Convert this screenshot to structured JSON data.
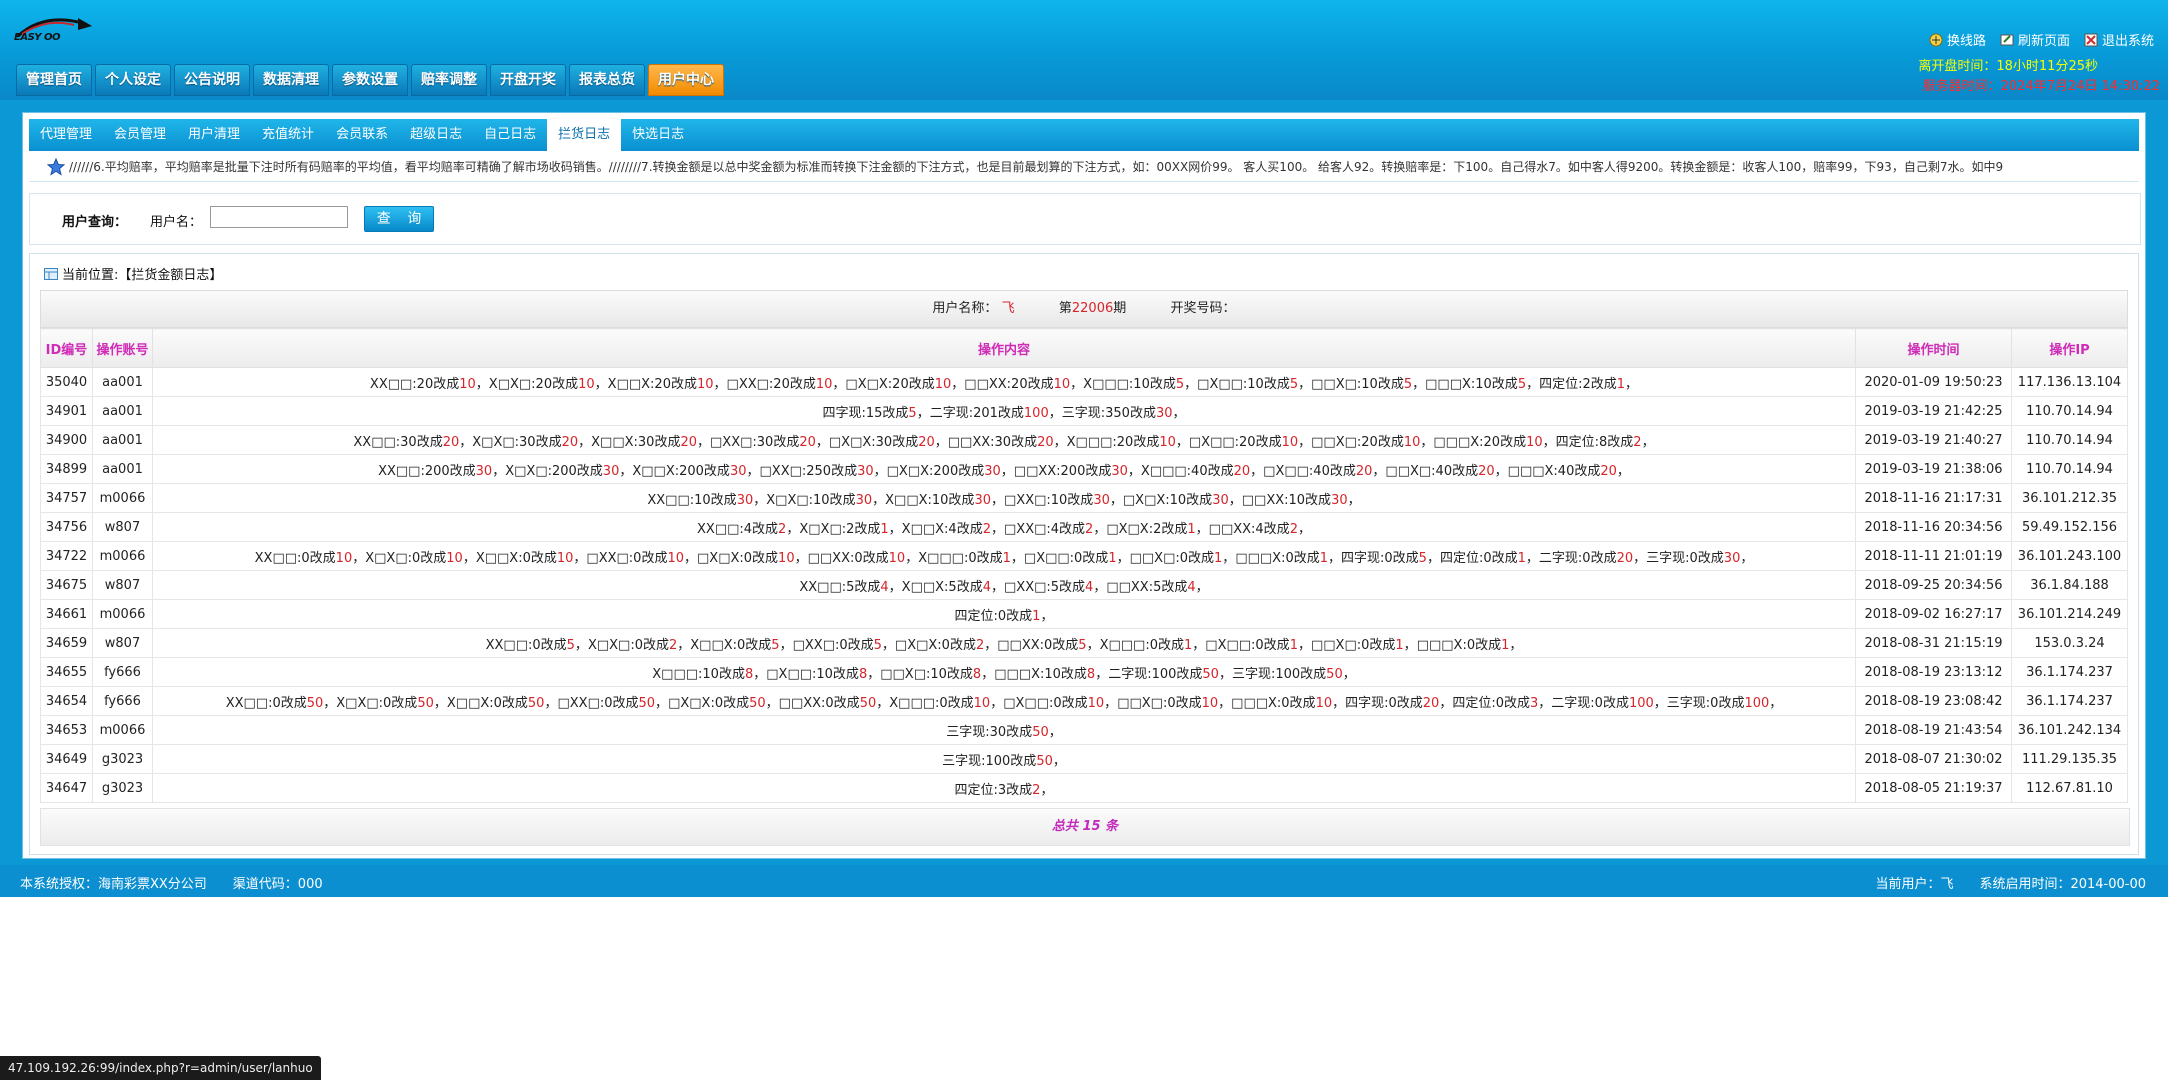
{
  "header": {
    "logo_text": "EASY OO",
    "nav": [
      "管理首页",
      "个人设定",
      "公告说明",
      "数据清理",
      "参数设置",
      "赔率调整",
      "开盘开奖",
      "报表总货",
      "用户中心"
    ],
    "links": [
      {
        "label": "换线路",
        "icon": "route-icon"
      },
      {
        "label": "刷新页面",
        "icon": "refresh-icon"
      },
      {
        "label": "退出系统",
        "icon": "logout-icon"
      }
    ],
    "time_label": "离开盘时间：18小时11分25秒",
    "server_time": "服务器时间：2024年7月24日 14:30:22"
  },
  "subnav": [
    "代理管理",
    "会员管理",
    "用户清理",
    "充值统计",
    "会员联系",
    "超级日志",
    "自己日志",
    "拦货日志",
    "快选日志"
  ],
  "marquee": "//////6.平均赔率，平均赔率是批量下注时所有码赔率的平均值，看平均赔率可精确了解市场收码销售。////////7.转换金额是以总中奖金额为标准而转换下注金额的下注方式，也是目前最划算的下注方式，如：00XX网价99。  客人买100。  给客人92。转换赔率是：下100。自己得水7。如中客人得9200。转换金额是：收客人100，赔率99，下93，自己剩7水。如中9",
  "search": {
    "label": "用户查询：",
    "field_label": "用户名：",
    "value": "",
    "button": "查 询"
  },
  "breadcrumb": "当前位置:【拦货金额日志】",
  "info": {
    "user_label": "用户名称：",
    "user": "飞",
    "period_prefix": "第",
    "period": "22006",
    "period_suffix": "期",
    "draw_label": "开奖号码："
  },
  "table": {
    "headers": [
      "ID编号",
      "操作账号",
      "操作内容",
      "操作时间",
      "操作IP"
    ],
    "rows": [
      {
        "id": "35040",
        "account": "aa001",
        "content": [
          [
            "XX□□:20改成",
            "10"
          ],
          [
            "X□X□:20改成",
            "10"
          ],
          [
            "X□□X:20改成",
            "10"
          ],
          [
            "□XX□:20改成",
            "10"
          ],
          [
            "□X□X:20改成",
            "10"
          ],
          [
            "□□XX:20改成",
            "10"
          ],
          [
            "X□□□:10改成",
            "5"
          ],
          [
            "□X□□:10改成",
            "5"
          ],
          [
            "□□X□:10改成",
            "5"
          ],
          [
            "□□□X:10改成",
            "5"
          ],
          [
            "四定位:2改成",
            "1"
          ]
        ],
        "time": "2020-01-09 19:50:23",
        "ip": "117.136.13.104"
      },
      {
        "id": "34901",
        "account": "aa001",
        "content": [
          [
            "四字现:15改成",
            "5"
          ],
          [
            "二字现:201改成",
            "100"
          ],
          [
            "三字现:350改成",
            "30"
          ]
        ],
        "time": "2019-03-19 21:42:25",
        "ip": "110.70.14.94"
      },
      {
        "id": "34900",
        "account": "aa001",
        "content": [
          [
            "XX□□:30改成",
            "20"
          ],
          [
            "X□X□:30改成",
            "20"
          ],
          [
            "X□□X:30改成",
            "20"
          ],
          [
            "□XX□:30改成",
            "20"
          ],
          [
            "□X□X:30改成",
            "20"
          ],
          [
            "□□XX:30改成",
            "20"
          ],
          [
            "X□□□:20改成",
            "10"
          ],
          [
            "□X□□:20改成",
            "10"
          ],
          [
            "□□X□:20改成",
            "10"
          ],
          [
            "□□□X:20改成",
            "10"
          ],
          [
            "四定位:8改成",
            "2"
          ]
        ],
        "time": "2019-03-19 21:40:27",
        "ip": "110.70.14.94"
      },
      {
        "id": "34899",
        "account": "aa001",
        "content": [
          [
            "XX□□:200改成",
            "30"
          ],
          [
            "X□X□:200改成",
            "30"
          ],
          [
            "X□□X:200改成",
            "30"
          ],
          [
            "□XX□:250改成",
            "30"
          ],
          [
            "□X□X:200改成",
            "30"
          ],
          [
            "□□XX:200改成",
            "30"
          ],
          [
            "X□□□:40改成",
            "20"
          ],
          [
            "□X□□:40改成",
            "20"
          ],
          [
            "□□X□:40改成",
            "20"
          ],
          [
            "□□□X:40改成",
            "20"
          ]
        ],
        "time": "2019-03-19 21:38:06",
        "ip": "110.70.14.94"
      },
      {
        "id": "34757",
        "account": "m0066",
        "content": [
          [
            "XX□□:10改成",
            "30"
          ],
          [
            "X□X□:10改成",
            "30"
          ],
          [
            "X□□X:10改成",
            "30"
          ],
          [
            "□XX□:10改成",
            "30"
          ],
          [
            "□X□X:10改成",
            "30"
          ],
          [
            "□□XX:10改成",
            "30"
          ]
        ],
        "time": "2018-11-16 21:17:31",
        "ip": "36.101.212.35"
      },
      {
        "id": "34756",
        "account": "w807",
        "content": [
          [
            "XX□□:4改成",
            "2"
          ],
          [
            "X□X□:2改成",
            "1"
          ],
          [
            "X□□X:4改成",
            "2"
          ],
          [
            "□XX□:4改成",
            "2"
          ],
          [
            "□X□X:2改成",
            "1"
          ],
          [
            "□□XX:4改成",
            "2"
          ]
        ],
        "time": "2018-11-16 20:34:56",
        "ip": "59.49.152.156"
      },
      {
        "id": "34722",
        "account": "m0066",
        "content": [
          [
            "XX□□:0改成",
            "10"
          ],
          [
            "X□X□:0改成",
            "10"
          ],
          [
            "X□□X:0改成",
            "10"
          ],
          [
            "□XX□:0改成",
            "10"
          ],
          [
            "□X□X:0改成",
            "10"
          ],
          [
            "□□XX:0改成",
            "10"
          ],
          [
            "X□□□:0改成",
            "1"
          ],
          [
            "□X□□:0改成",
            "1"
          ],
          [
            "□□X□:0改成",
            "1"
          ],
          [
            "□□□X:0改成",
            "1"
          ],
          [
            "四字现:0改成",
            "5"
          ],
          [
            "四定位:0改成",
            "1"
          ],
          [
            "二字现:0改成",
            "20"
          ],
          [
            "三字现:0改成",
            "30"
          ]
        ],
        "time": "2018-11-11 21:01:19",
        "ip": "36.101.243.100"
      },
      {
        "id": "34675",
        "account": "w807",
        "content": [
          [
            "XX□□:5改成",
            "4"
          ],
          [
            "X□□X:5改成",
            "4"
          ],
          [
            "□XX□:5改成",
            "4"
          ],
          [
            "□□XX:5改成",
            "4"
          ]
        ],
        "time": "2018-09-25 20:34:56",
        "ip": "36.1.84.188"
      },
      {
        "id": "34661",
        "account": "m0066",
        "content": [
          [
            "四定位:0改成",
            "1"
          ]
        ],
        "time": "2018-09-02 16:27:17",
        "ip": "36.101.214.249"
      },
      {
        "id": "34659",
        "account": "w807",
        "content": [
          [
            "XX□□:0改成",
            "5"
          ],
          [
            "X□X□:0改成",
            "2"
          ],
          [
            "X□□X:0改成",
            "5"
          ],
          [
            "□XX□:0改成",
            "5"
          ],
          [
            "□X□X:0改成",
            "2"
          ],
          [
            "□□XX:0改成",
            "5"
          ],
          [
            "X□□□:0改成",
            "1"
          ],
          [
            "□X□□:0改成",
            "1"
          ],
          [
            "□□X□:0改成",
            "1"
          ],
          [
            "□□□X:0改成",
            "1"
          ]
        ],
        "time": "2018-08-31 21:15:19",
        "ip": "153.0.3.24"
      },
      {
        "id": "34655",
        "account": "fy666",
        "content": [
          [
            "X□□□:10改成",
            "8"
          ],
          [
            "□X□□:10改成",
            "8"
          ],
          [
            "□□X□:10改成",
            "8"
          ],
          [
            "□□□X:10改成",
            "8"
          ],
          [
            "二字现:100改成",
            "50"
          ],
          [
            "三字现:100改成",
            "50"
          ]
        ],
        "time": "2018-08-19 23:13:12",
        "ip": "36.1.174.237"
      },
      {
        "id": "34654",
        "account": "fy666",
        "content": [
          [
            "XX□□:0改成",
            "50"
          ],
          [
            "X□X□:0改成",
            "50"
          ],
          [
            "X□□X:0改成",
            "50"
          ],
          [
            "□XX□:0改成",
            "50"
          ],
          [
            "□X□X:0改成",
            "50"
          ],
          [
            "□□XX:0改成",
            "50"
          ],
          [
            "X□□□:0改成",
            "10"
          ],
          [
            "□X□□:0改成",
            "10"
          ],
          [
            "□□X□:0改成",
            "10"
          ],
          [
            "□□□X:0改成",
            "10"
          ],
          [
            "四字现:0改成",
            "20"
          ],
          [
            "四定位:0改成",
            "3"
          ],
          [
            "二字现:0改成",
            "100"
          ],
          [
            "三字现:0改成",
            "100"
          ]
        ],
        "time": "2018-08-19 23:08:42",
        "ip": "36.1.174.237"
      },
      {
        "id": "34653",
        "account": "m0066",
        "content": [
          [
            "三字现:30改成",
            "50"
          ]
        ],
        "time": "2018-08-19 21:43:54",
        "ip": "36.101.242.134"
      },
      {
        "id": "34649",
        "account": "g3023",
        "content": [
          [
            "三字现:100改成",
            "50"
          ]
        ],
        "time": "2018-08-07 21:30:02",
        "ip": "111.29.135.35"
      },
      {
        "id": "34647",
        "account": "g3023",
        "content": [
          [
            "四定位:3改成",
            "2"
          ]
        ],
        "time": "2018-08-05 21:19:37",
        "ip": "112.67.81.10"
      }
    ],
    "total": "总共 15 条"
  },
  "footer": {
    "left": "本系统授权：海南彩票XX分公司　　渠道代码：000",
    "right": "当前用户：飞　　系统启用时间：2014-00-00"
  },
  "status_url": "47.109.192.26:99/index.php?r=admin/user/lanhuo",
  "colors": {
    "accent": "#0c98d4",
    "active_nav": "#f28a00",
    "header_text": "#d02bb7",
    "highlight": "#d6242a"
  }
}
